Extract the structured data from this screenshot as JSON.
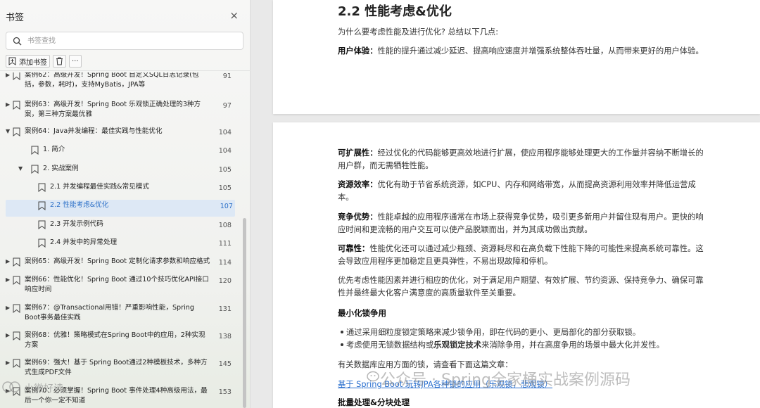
{
  "sidebar": {
    "title": "书签",
    "close_icon": "×",
    "search_placeholder": "书签查找",
    "toolbar": {
      "add_label": "添加书签",
      "more_label": "···"
    },
    "items": [
      {
        "text": "案例62：高级开发！Spring Boot 自定义SQL日志记录(包括，参数，耗时)，支持MyBatis，JPA等",
        "page": "91",
        "level": 0,
        "arrow": "▶"
      },
      {
        "text": "案例63：高级开发！Spring Boot 乐观锁正确处理的3种方案，第三种方案最优雅",
        "page": "97",
        "level": 0,
        "arrow": "▶"
      },
      {
        "text": "案例64：Java并发编程：最佳实践与性能优化",
        "page": "104",
        "level": 0,
        "arrow": "▼"
      },
      {
        "text": "1. 简介",
        "page": "104",
        "level": 1,
        "arrow": ""
      },
      {
        "text": "2. 实战案例",
        "page": "105",
        "level": 1,
        "arrow": "▼"
      },
      {
        "text": "2.1 并发编程最佳实践&常见模式",
        "page": "105",
        "level": 2,
        "arrow": ""
      },
      {
        "text": "2.2 性能考虑&优化",
        "page": "107",
        "level": 2,
        "arrow": "",
        "active": true
      },
      {
        "text": "2.3 开发示例代码",
        "page": "108",
        "level": 2,
        "arrow": ""
      },
      {
        "text": "2.4 并发中的异常处理",
        "page": "111",
        "level": 2,
        "arrow": ""
      },
      {
        "text": "案例65：高级开发！Spring Boot 定制化请求参数和响应格式",
        "page": "114",
        "level": 0,
        "arrow": "▶"
      },
      {
        "text": "案例66：性能优化！Spring Boot 通过10个技巧优化API接口响应时间",
        "page": "120",
        "level": 0,
        "arrow": "▶"
      },
      {
        "text": "案例67：@Transactional用错！严重影响性能，Spring Boot事务最佳实践",
        "page": "131",
        "level": 0,
        "arrow": "▶"
      },
      {
        "text": "案例68：优雅！策略模式在Spring Boot中的应用，2种实现方案",
        "page": "138",
        "level": 0,
        "arrow": "▶"
      },
      {
        "text": "案例69：强大！基于 Spring Boot通过2种模板技术，多种方式生成PDF文件",
        "page": "145",
        "level": 0,
        "arrow": "▶"
      },
      {
        "text": "案例70：必须掌握！Spring Boot 事件处理4种高级用法，最后一个你一定不知道",
        "page": "153",
        "level": 0,
        "arrow": "▶"
      }
    ]
  },
  "doc": {
    "heading": "2.2 性能考虑&优化",
    "intro": "为什么要考虑性能及进行优化? 总结以下几点:",
    "ux_label": "用户体验：",
    "ux_text": "性能的提升通过减少延迟、提高响应速度并增强系统整体吞吐量，从而带来更好的用户体验。",
    "scal_label": "可扩展性：",
    "scal_text": "经过优化的代码能够更高效地进行扩展，使应用程序能够处理更大的工作量并容纳不断增长的用户群，而无需牺牲性能。",
    "res_label": "资源效率：",
    "res_text": "优化有助于节省系统资源，如CPU、内存和网络带宽，从而提高资源利用效率并降低运营成本。",
    "comp_label": "竞争优势：",
    "comp_text": "性能卓越的应用程序通常在市场上获得竞争优势，吸引更多新用户并留住现有用户。更快的响应时间和更流畅的用户交互可以使产品脱颖而出，并为其成功做出贡献。",
    "rel_label": "可靠性：",
    "rel_text": "性能优化还可以通过减少瓶颈、资源耗尽和在高负载下性能下降的可能性来提高系统可靠性。这会导致应用程序更加稳定且更具弹性，不易出现故障和停机。",
    "summary": "优先考虑性能因素并进行相应的优化，对于满足用户期望、有效扩展、节约资源、保持竞争力、确保可靠性并最终最大化客户满意度的高质量软件至关重要。",
    "lock_heading": "最小化锁争用",
    "bullet1": "通过采用细粒度锁定策略来减少锁争用，即在代码的更小、更局部化的部分获取锁。",
    "bullet2_pre": "考虑使用无锁数据结构或",
    "bullet2_bold": "乐观锁定技术",
    "bullet2_post": "来消除争用，并在高度争用的场景中最大化并发性。",
    "ref_text": "有关数据库应用方面的锁，请查看下面这篇文章：",
    "link_text": "基于 Spring Boot 玩转JPA各种锁的应用（乐观锁，悲观锁）",
    "batch_heading": "批量处理&分块处理"
  },
  "watermark": {
    "main": "公众号 · Spring全家桶实战案例源码",
    "left": "小微好读"
  }
}
